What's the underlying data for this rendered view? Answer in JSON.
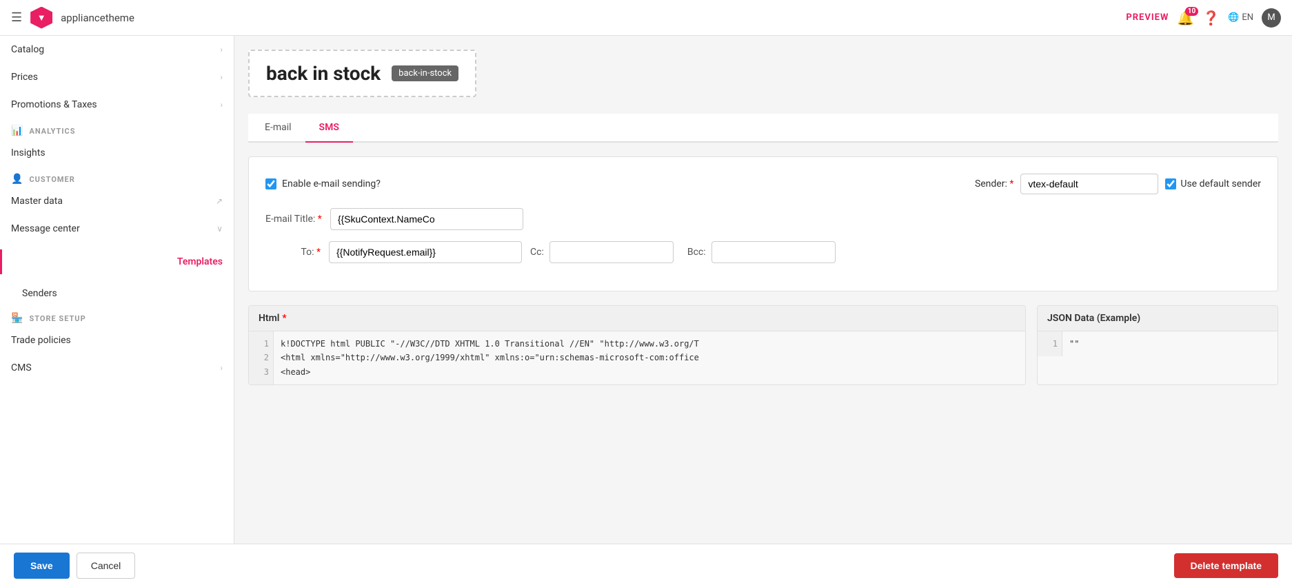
{
  "topbar": {
    "app_name": "appliancetheme",
    "preview_label": "PREVIEW",
    "bell_count": "10",
    "lang": "EN",
    "avatar_label": "M"
  },
  "sidebar": {
    "sections": [
      {
        "label": "",
        "items": [
          {
            "id": "catalog",
            "label": "Catalog",
            "hasChevron": true,
            "sub": false
          },
          {
            "id": "prices",
            "label": "Prices",
            "hasChevron": true,
            "sub": false
          },
          {
            "id": "promotions-taxes",
            "label": "Promotions & Taxes",
            "hasChevron": true,
            "sub": false
          }
        ]
      },
      {
        "label": "ANALYTICS",
        "icon": "bar-chart",
        "items": [
          {
            "id": "insights",
            "label": "Insights",
            "hasChevron": false,
            "sub": false
          }
        ]
      },
      {
        "label": "CUSTOMER",
        "icon": "person",
        "items": [
          {
            "id": "master-data",
            "label": "Master data",
            "hasChevron": false,
            "sub": false,
            "external": true
          },
          {
            "id": "message-center",
            "label": "Message center",
            "hasChevron": true,
            "sub": false
          },
          {
            "id": "templates",
            "label": "Templates",
            "hasChevron": false,
            "sub": true,
            "active": true
          },
          {
            "id": "senders",
            "label": "Senders",
            "hasChevron": false,
            "sub": true
          }
        ]
      },
      {
        "label": "STORE SETUP",
        "icon": "store",
        "items": [
          {
            "id": "trade-policies",
            "label": "Trade policies",
            "hasChevron": false,
            "sub": false
          },
          {
            "id": "cms",
            "label": "CMS",
            "hasChevron": true,
            "sub": false
          }
        ]
      }
    ]
  },
  "template": {
    "title": "back in stock",
    "badge": "back-in-stock"
  },
  "tabs": [
    {
      "id": "email",
      "label": "E-mail",
      "active": false
    },
    {
      "id": "sms",
      "label": "SMS",
      "active": true
    }
  ],
  "form": {
    "enable_email_label": "Enable e-mail sending?",
    "sender_label": "Sender:",
    "sender_value": "vtex-default",
    "use_default_label": "Use default sender",
    "email_title_label": "E-mail Title:",
    "email_title_value": "{{SkuContext.NameCo",
    "to_label": "To:",
    "to_value": "{{NotifyRequest.email}}",
    "cc_label": "Cc:",
    "cc_value": "",
    "bcc_label": "Bcc:",
    "bcc_value": ""
  },
  "html_section": {
    "label": "Html",
    "required": true,
    "lines": [
      {
        "num": "1",
        "content": "k!DOCTYPE html PUBLIC \"-//W3C//DTD XHTML 1.0 Transitional //EN\" \"http://www.w3.org/T"
      },
      {
        "num": "2",
        "content": "<html xmlns=\"http://www.w3.org/1999/xhtml\" xmlns:o=\"urn:schemas-microsoft-com:office"
      },
      {
        "num": "3",
        "content": "<head>"
      }
    ]
  },
  "json_section": {
    "label": "JSON Data (Example)",
    "lines": [
      {
        "num": "1",
        "content": "\"\""
      }
    ]
  },
  "buttons": {
    "save_label": "Save",
    "cancel_label": "Cancel",
    "delete_label": "Delete template"
  }
}
